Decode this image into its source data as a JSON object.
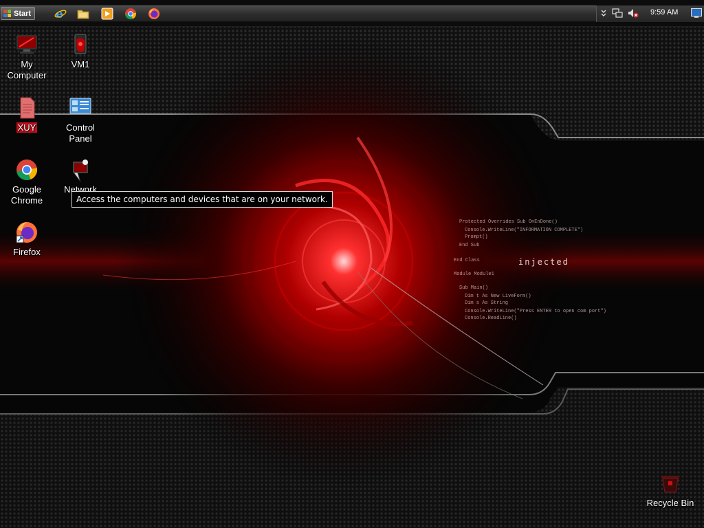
{
  "taskbar": {
    "start_label": "Start",
    "quick_launch": [
      {
        "name": "internet-explorer-icon"
      },
      {
        "name": "file-explorer-icon"
      },
      {
        "name": "media-player-icon"
      },
      {
        "name": "chrome-icon"
      },
      {
        "name": "firefox-icon"
      }
    ],
    "tray": {
      "icons": [
        "show-hidden-icons-icon",
        "network-icon",
        "volume-muted-icon",
        "show-desktop-icon"
      ],
      "clock": "9:59 AM"
    }
  },
  "desktop": {
    "icons": [
      {
        "label_line1": "My",
        "label_line2": "Computer",
        "icon": "computer-icon"
      },
      {
        "label_line1": "VM1",
        "label_line2": "",
        "icon": "vm-icon"
      },
      {
        "label_line1": "XUY",
        "label_line2": "",
        "icon": "document-icon"
      },
      {
        "label_line1": "Control",
        "label_line2": "Panel",
        "icon": "control-panel-icon"
      },
      {
        "label_line1": "Google",
        "label_line2": "Chrome",
        "icon": "chrome-icon"
      },
      {
        "label_line1": "Network",
        "label_line2": "",
        "icon": "network-icon"
      },
      {
        "label_line1": "Firefox",
        "label_line2": "",
        "icon": "firefox-icon"
      },
      {
        "label_line1": "Recycle Bin",
        "label_line2": "",
        "icon": "recycle-bin-icon"
      }
    ],
    "tooltip": "Access the computers and devices that are on your network."
  },
  "wallpaper": {
    "word": "injected",
    "code_lines": [
      "Protected Overrides Sub OnEnDone()",
      "Console.WriteLine(\"INFORMATION COMPLETE\")",
      "Prompt()",
      "End Sub",
      "End Class",
      "Module Module1",
      "Sub Main()",
      "Dim t As New LiveForm()",
      "Dim s As String",
      "Console.WriteLine(\"Press ENTER to open com port\")",
      "Console.ReadLine()"
    ]
  },
  "colors": {
    "accent_red": "#c20e1a",
    "taskbar": "#2e2e2e",
    "background": "#050505"
  }
}
